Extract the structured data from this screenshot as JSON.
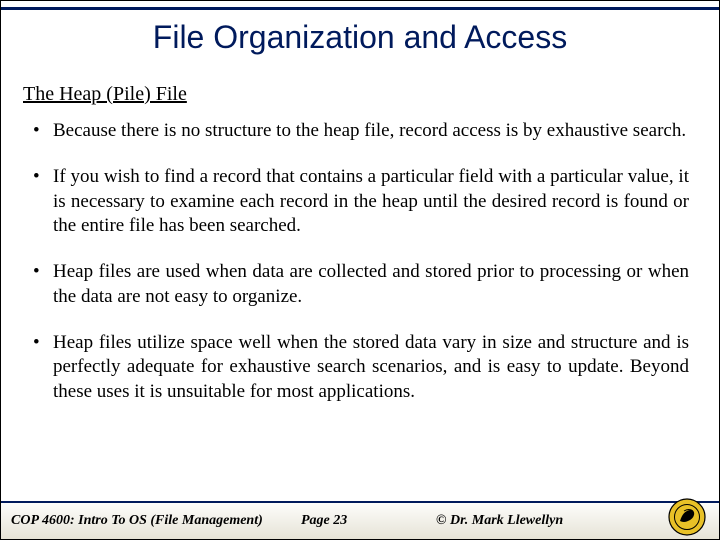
{
  "title": "File Organization and Access",
  "subhead": "The Heap (Pile) File",
  "bullets": [
    "Because there is no structure to the heap file, record access is by exhaustive search.",
    "If you wish to find a record that contains a particular field with a particular value, it is necessary to examine each record in the heap until the desired record is found or the entire file has been searched.",
    "Heap files are used when data are collected and stored prior to processing or when the data are not easy to organize.",
    "Heap files utilize space well when the stored data vary in size and structure and is perfectly adequate for exhaustive search scenarios, and is easy to update.  Beyond these uses it is unsuitable for most applications."
  ],
  "footer": {
    "course": "COP 4600: Intro To OS  (File Management)",
    "page": "Page 23",
    "copyright": "© Dr. Mark Llewellyn"
  }
}
